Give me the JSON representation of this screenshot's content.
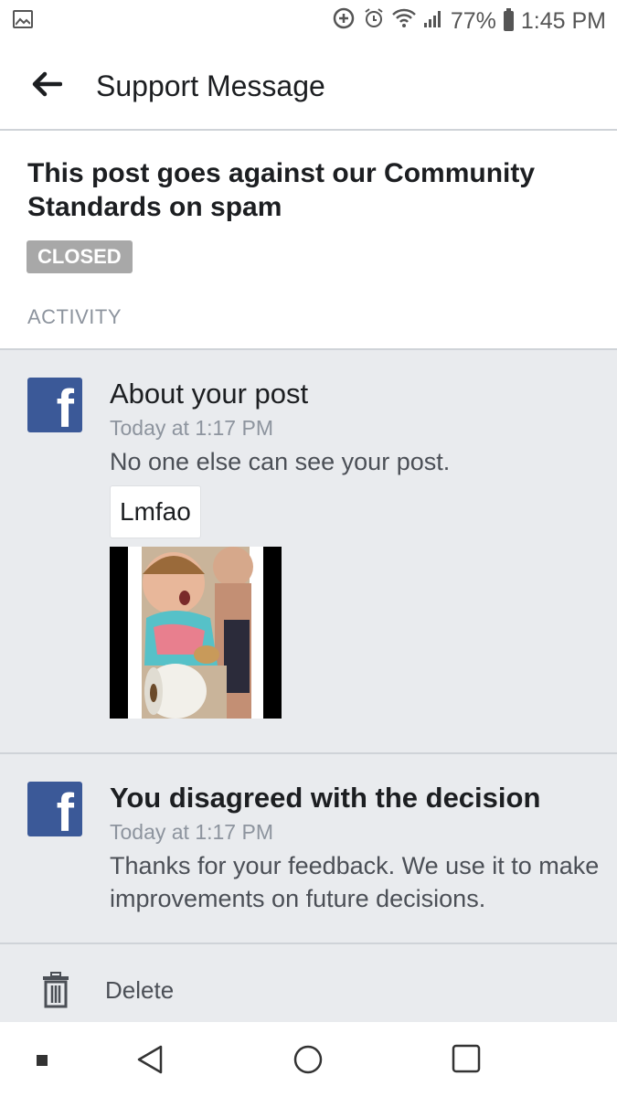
{
  "status_bar": {
    "battery": "77%",
    "time": "1:45 PM",
    "icons": [
      "gallery-icon",
      "data-saver-icon",
      "alarm-icon",
      "wifi-icon",
      "signal-icon",
      "battery-icon"
    ]
  },
  "header": {
    "title": "Support Message",
    "back_icon": "back-arrow-icon"
  },
  "ticket": {
    "title": "This post goes against our Community Standards on spam",
    "status": "CLOSED",
    "activity_label": "ACTIVITY"
  },
  "activity": [
    {
      "title": "About your post",
      "time": "Today at 1:17 PM",
      "body": "No one else can see your post.",
      "post_caption": "Lmfao",
      "icon": "facebook-icon"
    },
    {
      "title": "You disagreed with the decision",
      "time": "Today at 1:17 PM",
      "body": "Thanks for your feedback. We use it to make improvements on future decisions.",
      "icon": "facebook-icon"
    }
  ],
  "actions": {
    "delete_label": "Delete"
  },
  "colors": {
    "facebook_blue": "#3b5998",
    "feed_background": "#e9ebee",
    "badge_gray": "#a8a8a8"
  }
}
